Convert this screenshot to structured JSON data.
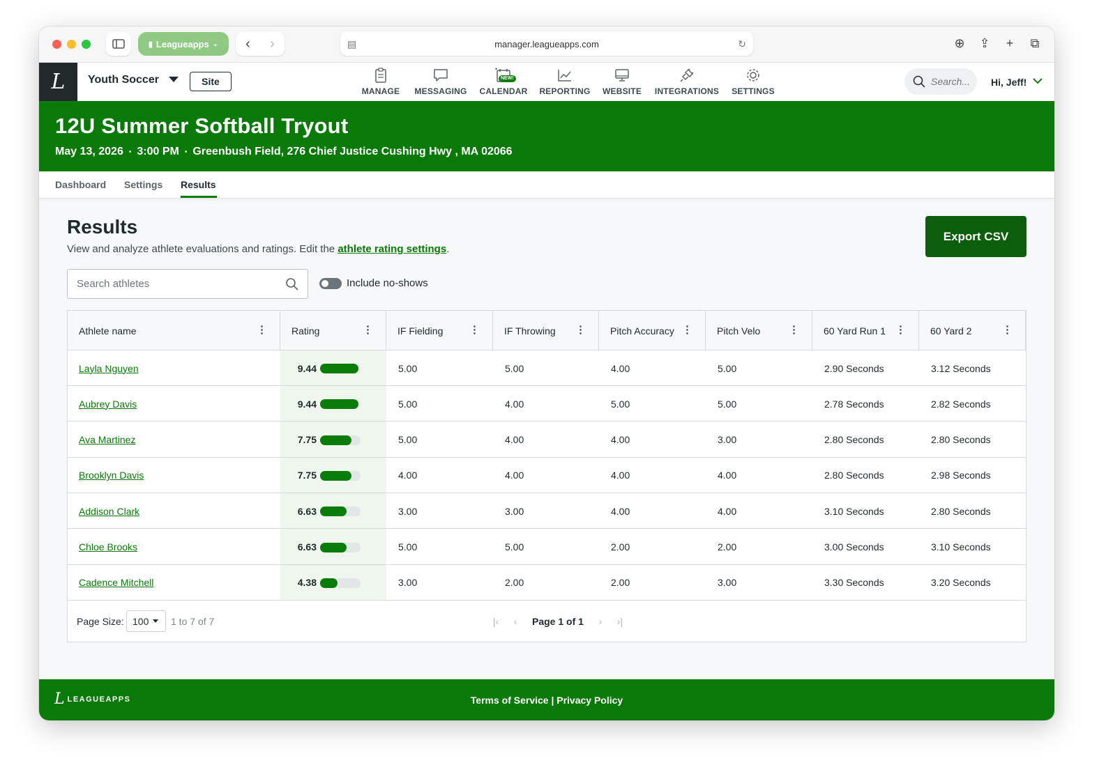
{
  "browser": {
    "workspace_label": "Leagueapps",
    "url": "manager.leagueapps.com"
  },
  "header": {
    "org_name": "Youth Soccer",
    "site_button": "Site",
    "nav": [
      {
        "label": "MANAGE",
        "icon": "clipboard-icon"
      },
      {
        "label": "MESSAGING",
        "icon": "chat-bubble-icon"
      },
      {
        "label": "CALENDAR",
        "icon": "calendar-icon",
        "badge": "NEW!"
      },
      {
        "label": "REPORTING",
        "icon": "line-chart-icon"
      },
      {
        "label": "WEBSITE",
        "icon": "monitor-icon"
      },
      {
        "label": "INTEGRATIONS",
        "icon": "plug-icon"
      },
      {
        "label": "SETTINGS",
        "icon": "gear-icon"
      }
    ],
    "search_placeholder": "Search...",
    "greeting": "Hi, Jeff!"
  },
  "event": {
    "title": "12U Summer Softball Tryout",
    "date": "May 13, 2026",
    "time": "3:00 PM",
    "location": "Greenbush Field, 276 Chief Justice Cushing Hwy , MA 02066"
  },
  "tabs": [
    "Dashboard",
    "Settings",
    "Results"
  ],
  "results": {
    "heading": "Results",
    "description": "View and analyze athlete evaluations and ratings. Edit the ",
    "link_text": "athlete rating settings",
    "description_end": ".",
    "export_label": "Export CSV",
    "search_placeholder": "Search athletes",
    "toggle_label": "Include no-shows"
  },
  "table": {
    "columns": [
      "Athlete name",
      "Rating",
      "IF Fielding",
      "IF Throwing",
      "Pitch Accuracy",
      "Pitch Velo",
      "60 Yard Run 1",
      "60 Yard 2"
    ],
    "rating_max": 10,
    "rows": [
      {
        "name": "Layla Nguyen",
        "rating": "9.44",
        "if_fielding": "5.00",
        "if_throwing": "5.00",
        "pitch_accuracy": "4.00",
        "pitch_velo": "5.00",
        "run1": "2.90 Seconds",
        "run2": "3.12 Seconds"
      },
      {
        "name": "Aubrey Davis",
        "rating": "9.44",
        "if_fielding": "5.00",
        "if_throwing": "4.00",
        "pitch_accuracy": "5.00",
        "pitch_velo": "5.00",
        "run1": "2.78 Seconds",
        "run2": "2.82 Seconds"
      },
      {
        "name": "Ava Martinez",
        "rating": "7.75",
        "if_fielding": "5.00",
        "if_throwing": "4.00",
        "pitch_accuracy": "4.00",
        "pitch_velo": "3.00",
        "run1": "2.80 Seconds",
        "run2": "2.80 Seconds"
      },
      {
        "name": "Brooklyn Davis",
        "rating": "7.75",
        "if_fielding": "4.00",
        "if_throwing": "4.00",
        "pitch_accuracy": "4.00",
        "pitch_velo": "4.00",
        "run1": "2.80 Seconds",
        "run2": "2.98 Seconds"
      },
      {
        "name": "Addison Clark",
        "rating": "6.63",
        "if_fielding": "3.00",
        "if_throwing": "3.00",
        "pitch_accuracy": "4.00",
        "pitch_velo": "4.00",
        "run1": "3.10 Seconds",
        "run2": "2.80 Seconds"
      },
      {
        "name": "Chloe Brooks",
        "rating": "6.63",
        "if_fielding": "5.00",
        "if_throwing": "5.00",
        "pitch_accuracy": "2.00",
        "pitch_velo": "2.00",
        "run1": "3.00 Seconds",
        "run2": "3.10 Seconds"
      },
      {
        "name": "Cadence Mitchell",
        "rating": "4.38",
        "if_fielding": "3.00",
        "if_throwing": "2.00",
        "pitch_accuracy": "2.00",
        "pitch_velo": "3.00",
        "run1": "3.30 Seconds",
        "run2": "3.20 Seconds"
      }
    ],
    "page_size_label": "Page Size:",
    "page_size": "100",
    "range_text": "1 to 7 of 7",
    "page_text": "Page 1 of 1"
  },
  "footer": {
    "logo_text": "LEAGUEAPPS",
    "links": "Terms of Service | Privacy Policy"
  },
  "colors": {
    "brand_green": "#097a08",
    "dark_green": "#0b5e0a",
    "rating_bar": "#0a7d09"
  }
}
